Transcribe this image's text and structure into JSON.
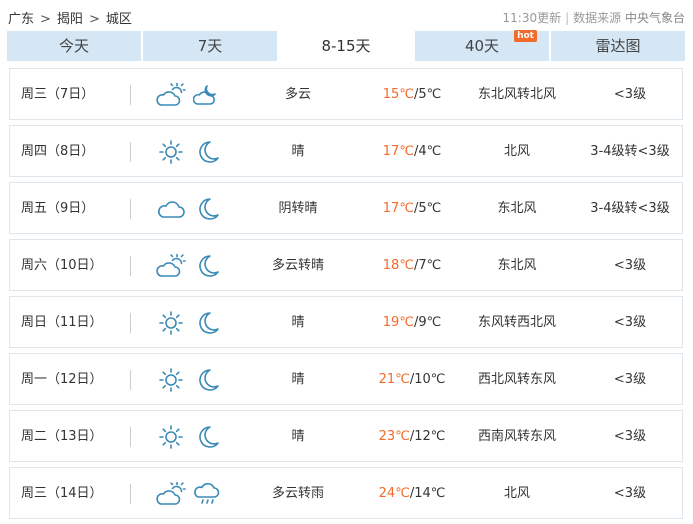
{
  "breadcrumb": {
    "province": "广东",
    "city": "揭阳",
    "district": "城区",
    "separator": ">"
  },
  "meta": {
    "update_time": "11:30更新",
    "source_label": "数据来源",
    "source_name": "中央气象台"
  },
  "tabs": [
    {
      "label": "今天"
    },
    {
      "label": "7天"
    },
    {
      "label": "8-15天",
      "active": true
    },
    {
      "label": "40天",
      "badge": "hot"
    },
    {
      "label": "雷达图"
    }
  ],
  "colors": {
    "accent_high_temp": "#f36b2b",
    "tab_bg": "#d5e6f4",
    "icon_stroke": "#3a8ab8"
  },
  "forecast": [
    {
      "date": "周三（7日）",
      "day_icon": "partly-cloudy-icon",
      "night_icon": "partly-cloudy-night-icon",
      "weather": "多云",
      "high": "15℃",
      "low": "/5℃",
      "wind": "东北风转北风",
      "level": "<3级"
    },
    {
      "date": "周四（8日）",
      "day_icon": "sun-icon",
      "night_icon": "moon-icon",
      "weather": "晴",
      "high": "17℃",
      "low": "/4℃",
      "wind": "北风",
      "level": "3-4级转<3级"
    },
    {
      "date": "周五（9日）",
      "day_icon": "cloud-icon",
      "night_icon": "moon-icon",
      "weather": "阴转晴",
      "high": "17℃",
      "low": "/5℃",
      "wind": "东北风",
      "level": "3-4级转<3级"
    },
    {
      "date": "周六（10日）",
      "day_icon": "partly-cloudy-icon",
      "night_icon": "moon-icon",
      "weather": "多云转晴",
      "high": "18℃",
      "low": "/7℃",
      "wind": "东北风",
      "level": "<3级"
    },
    {
      "date": "周日（11日）",
      "day_icon": "sun-icon",
      "night_icon": "moon-icon",
      "weather": "晴",
      "high": "19℃",
      "low": "/9℃",
      "wind": "东风转西北风",
      "level": "<3级"
    },
    {
      "date": "周一（12日）",
      "day_icon": "sun-icon",
      "night_icon": "moon-icon",
      "weather": "晴",
      "high": "21℃",
      "low": "/10℃",
      "wind": "西北风转东风",
      "level": "<3级"
    },
    {
      "date": "周二（13日）",
      "day_icon": "sun-icon",
      "night_icon": "moon-icon",
      "weather": "晴",
      "high": "23℃",
      "low": "/12℃",
      "wind": "西南风转东风",
      "level": "<3级"
    },
    {
      "date": "周三（14日）",
      "day_icon": "partly-cloudy-icon",
      "night_icon": "rain-cloud-icon",
      "weather": "多云转雨",
      "high": "24℃",
      "low": "/14℃",
      "wind": "北风",
      "level": "<3级"
    }
  ]
}
